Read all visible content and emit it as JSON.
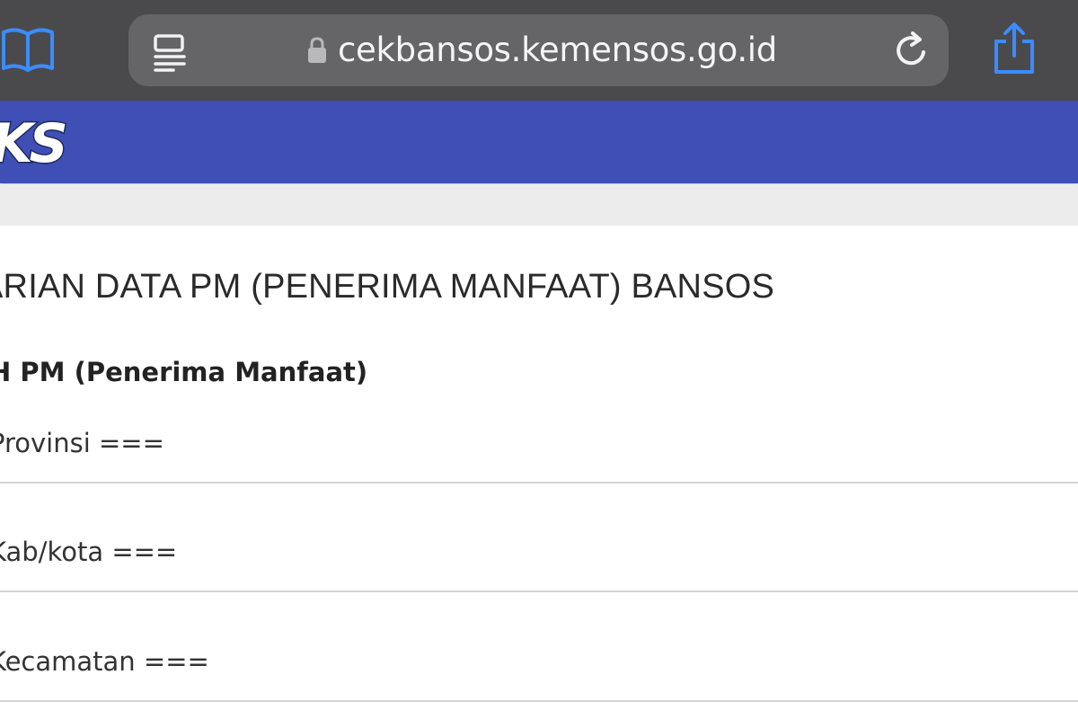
{
  "browser": {
    "url": "cekbansos.kemensos.go.id",
    "icons": {
      "bookmarks": "book-icon",
      "reader": "reader-mode-icon",
      "lock": "lock-icon",
      "reload": "reload-icon",
      "share": "share-icon"
    },
    "accent_color": "#3b8cff"
  },
  "site": {
    "header_color": "#3f4fb6",
    "logo_text": "KS"
  },
  "page": {
    "title": "ARIAN DATA PM (PENERIMA MANFAAT) BANSOS",
    "section_label": "H PM (Penerima Manfaat)",
    "selects": [
      {
        "value": "Provinsi ==="
      },
      {
        "value": "Kab/kota ==="
      },
      {
        "value": "Kecamatan ==="
      }
    ]
  }
}
